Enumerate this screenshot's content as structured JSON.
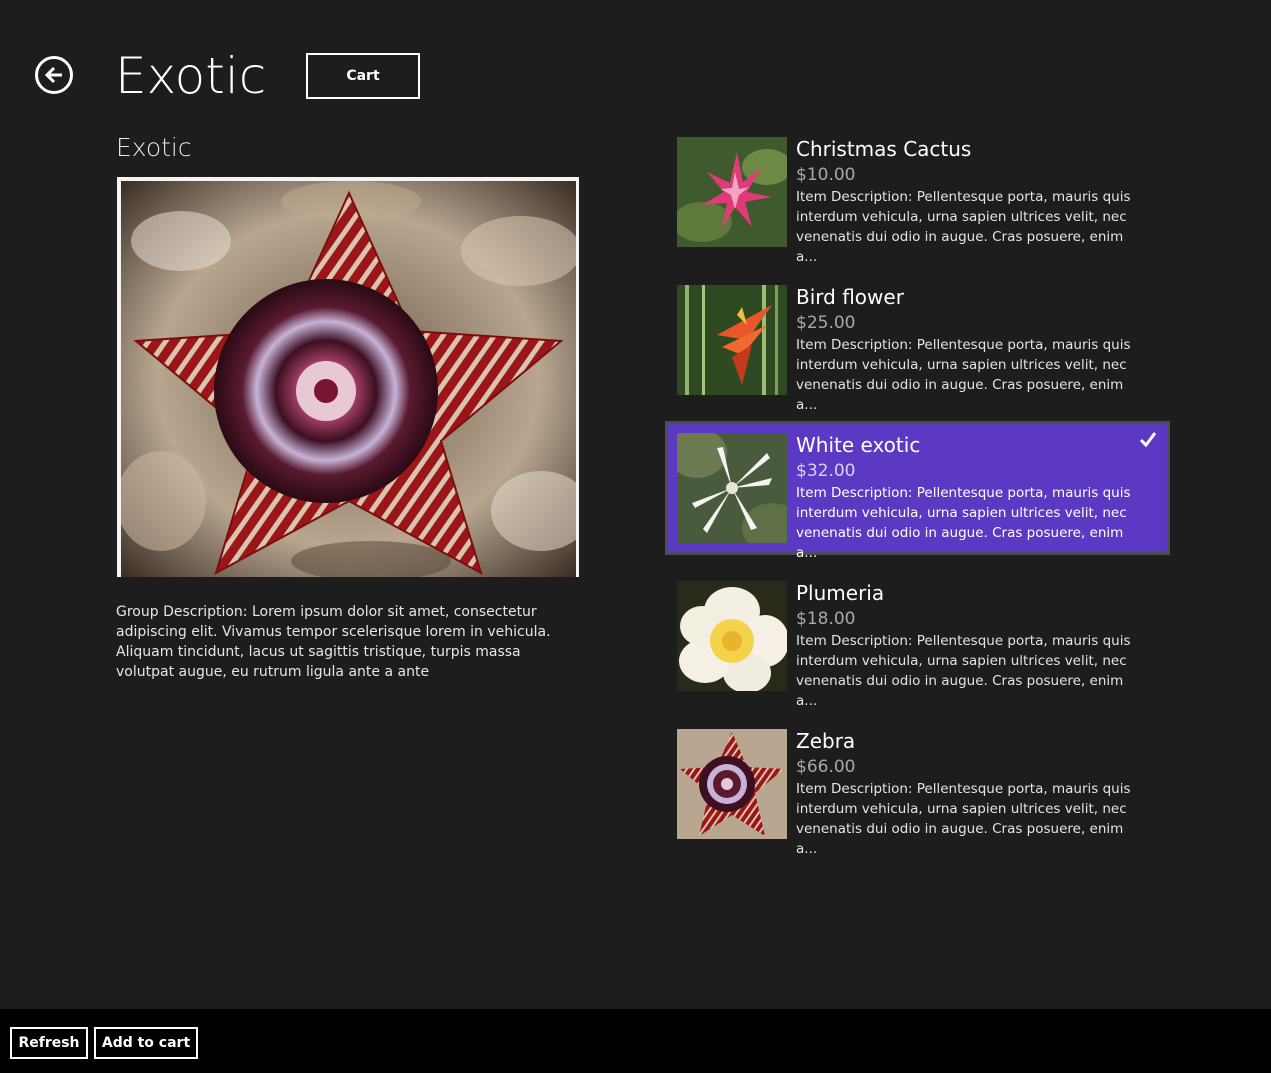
{
  "header": {
    "title": "Exotic",
    "cart_label": "Cart"
  },
  "group": {
    "title": "Exotic",
    "description": "Group Description: Lorem ipsum dolor sit amet, consectetur adipiscing elit. Vivamus tempor scelerisque lorem in vehicula. Aliquam tincidunt, lacus ut sagittis tristique, turpis massa volutpat augue, eu rutrum ligula ante a ante"
  },
  "items": [
    {
      "title": "Christmas Cactus",
      "price": "$10.00",
      "description": "Item Description: Pellentesque porta, mauris quis interdum vehicula, urna sapien ultrices velit, nec venenatis dui odio in augue. Cras posuere, enim a...",
      "selected": false
    },
    {
      "title": "Bird flower",
      "price": "$25.00",
      "description": "Item Description: Pellentesque porta, mauris quis interdum vehicula, urna sapien ultrices velit, nec venenatis dui odio in augue. Cras posuere, enim a...",
      "selected": false
    },
    {
      "title": "White exotic",
      "price": "$32.00",
      "description": "Item Description: Pellentesque porta, mauris quis interdum vehicula, urna sapien ultrices velit, nec venenatis dui odio in augue. Cras posuere, enim a...",
      "selected": true
    },
    {
      "title": "Plumeria",
      "price": "$18.00",
      "description": "Item Description: Pellentesque porta, mauris quis interdum vehicula, urna sapien ultrices velit, nec venenatis dui odio in augue. Cras posuere, enim a...",
      "selected": false
    },
    {
      "title": "Zebra",
      "price": "$66.00",
      "description": "Item Description: Pellentesque porta, mauris quis interdum vehicula, urna sapien ultrices velit, nec venenatis dui odio in augue. Cras posuere, enim a...",
      "selected": false
    }
  ],
  "appbar": {
    "refresh_label": "Refresh",
    "add_to_cart_label": "Add to cart"
  },
  "colors": {
    "background": "#1d1d1d",
    "selection": "#5b39c3",
    "appbar": "#000000"
  },
  "icons": {
    "back": "back-arrow-icon",
    "check": "checkmark-icon"
  }
}
